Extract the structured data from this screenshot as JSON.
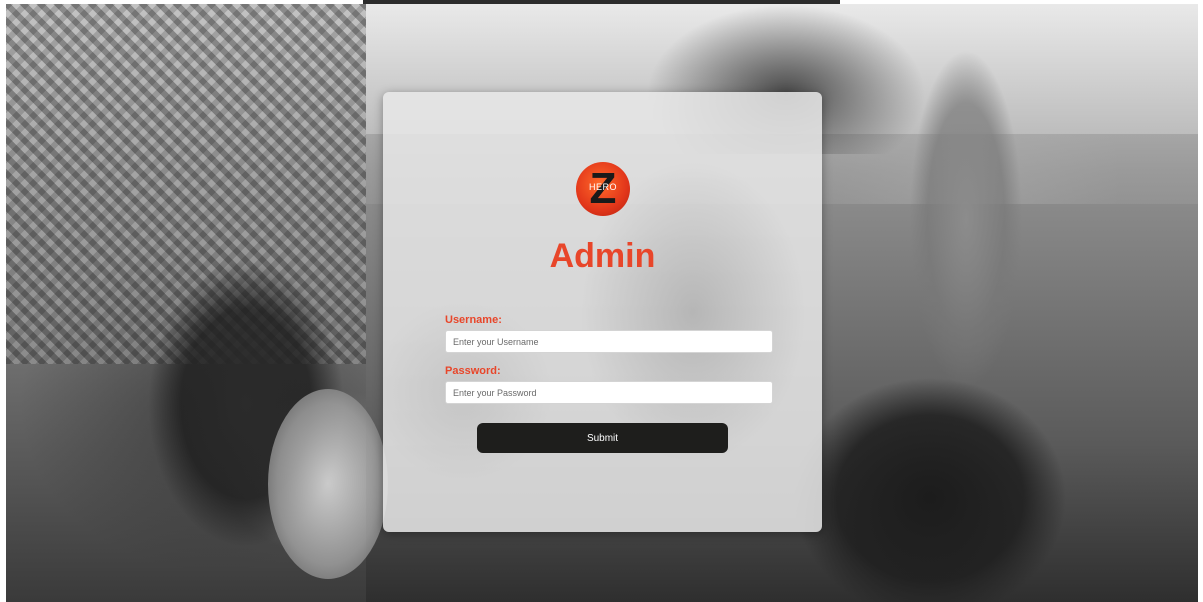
{
  "logo": {
    "letter": "Z",
    "text": "HERO",
    "icon": "z-hero-logo-icon",
    "colors": {
      "circle": "#e8462a",
      "letter": "#1a1a1a"
    }
  },
  "login": {
    "title": "Admin",
    "username_label": "Username:",
    "username_placeholder": "Enter your Username",
    "username_value": "",
    "password_label": "Password:",
    "password_placeholder": "Enter your Password",
    "password_value": "",
    "submit_label": "Submit"
  },
  "colors": {
    "accent": "#e8462a",
    "button": "#1e1e1c",
    "card": "#e8e8e8"
  }
}
